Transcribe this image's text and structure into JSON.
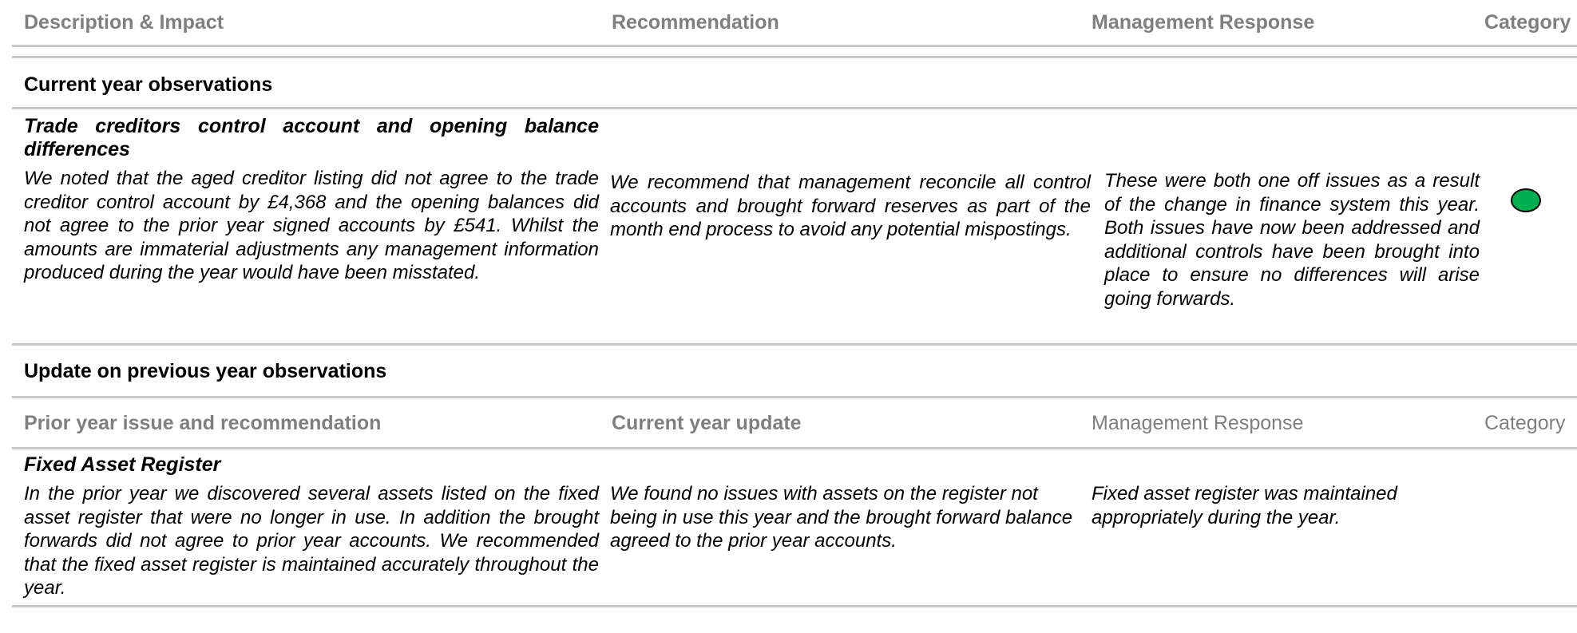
{
  "header": {
    "col1": "Description & Impact",
    "col2": "Recommendation",
    "col3": "Management Response",
    "col4": "Category"
  },
  "current_section": {
    "title": "Current year observations",
    "item": {
      "title": "Trade creditors control account and opening balance differences",
      "description": "We noted that the aged creditor listing did not agree to the trade creditor control account by £4,368 and the opening balances did not agree to the prior year signed accounts by £541. Whilst the amounts are immaterial adjustments any management information produced during the year would have been misstated.",
      "recommendation": "We recommend that management reconcile all control accounts and brought forward reserves as part of the month end process to avoid any potential mispostings.",
      "management_response": "These were both one off issues as a result of the change in finance system this year. Both issues have now been addressed and additional controls have been brought into place to ensure no differences will arise going forwards.",
      "category_color": "#00b050"
    }
  },
  "previous_section": {
    "title": "Update on previous year observations",
    "header": {
      "col1": "Prior year issue and recommendation",
      "col2": "Current year update",
      "col3": "Management Response",
      "col4": "Category"
    },
    "item": {
      "title": "Fixed Asset Register",
      "description": "In the prior year we discovered several assets listed on the fixed asset register that were no longer in use. In addition the brought forwards did not agree to prior year accounts. We recommended that the fixed asset register is maintained accurately throughout the year.",
      "update": "We found no issues with assets on the register not being in use this year and the brought forward balance agreed to the prior year accounts.",
      "management_response": "Fixed asset register was maintained appropriately during the year."
    }
  }
}
